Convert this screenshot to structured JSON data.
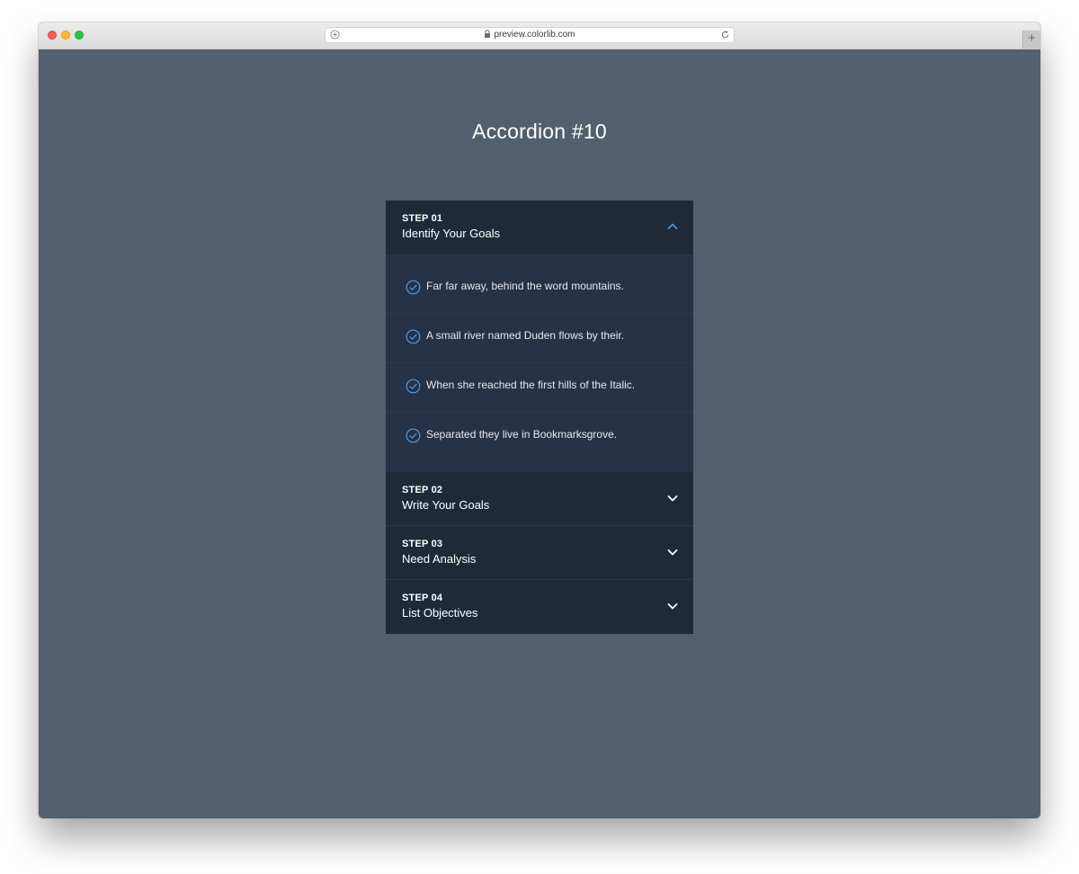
{
  "browser": {
    "url": "preview.colorlib.com",
    "new_tab_label": "+"
  },
  "page": {
    "title": "Accordion #10"
  },
  "accordion": {
    "steps": [
      {
        "label": "STEP 01",
        "title": "Identify Your Goals",
        "expanded": true,
        "items": [
          "Far far away, behind the word mountains.",
          "A small river named Duden flows by their.",
          "When she reached the first hills of the Italic.",
          "Separated they live in Bookmarksgrove."
        ]
      },
      {
        "label": "STEP 02",
        "title": "Write Your Goals",
        "expanded": false
      },
      {
        "label": "STEP 03",
        "title": "Need Analysis",
        "expanded": false
      },
      {
        "label": "STEP 04",
        "title": "List Objectives",
        "expanded": false
      }
    ]
  },
  "colors": {
    "page_background": "#525f6e",
    "header_background": "#202938",
    "body_background": "#263246",
    "accent": "#4f9be0",
    "text": "#ffffff"
  }
}
